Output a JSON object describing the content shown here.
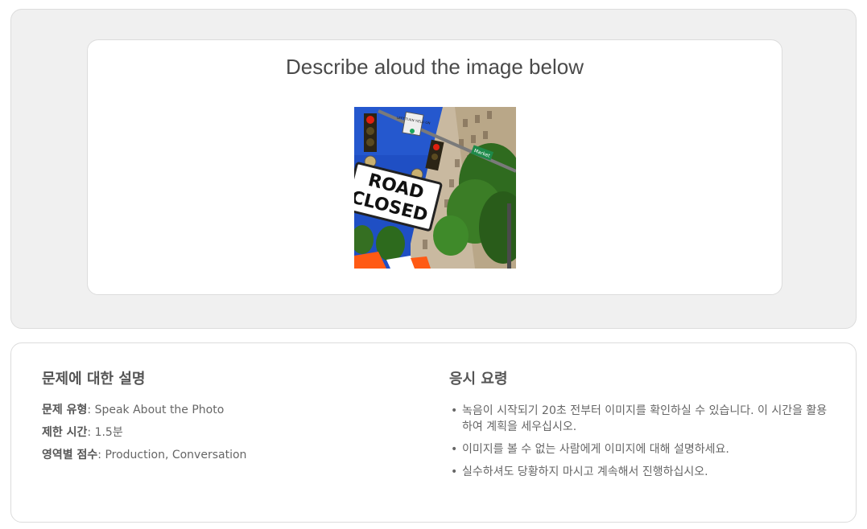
{
  "prompt": {
    "title": "Describe aloud the image below",
    "image": {
      "sign_line1": "ROAD",
      "sign_line2": "CLOSED",
      "street_sign": "Market",
      "small_sign": "LEFT TURN YIELD ON"
    }
  },
  "description": {
    "heading": "문제에 대한 설명",
    "rows": [
      {
        "label": "문제 유형",
        "value": "Speak About the Photo"
      },
      {
        "label": "제한 시간",
        "value": "1.5분"
      },
      {
        "label": "영역별 점수",
        "value": "Production, Conversation"
      }
    ]
  },
  "tips": {
    "heading": "응시 요령",
    "items": [
      "녹음이 시작되기 20초 전부터 이미지를 확인하실 수 있습니다. 이 시간을 활용하여 계획을 세우십시오.",
      "이미지를 볼 수 없는 사람에게 이미지에 대해 설명하세요.",
      "실수하셔도 당황하지 마시고 계속해서 진행하십시오."
    ]
  },
  "colors": {
    "panel_bg": "#f0f0f0",
    "border": "#dcdcdc",
    "sky": "#1f4fc4",
    "barrier_orange": "#ff5a14"
  }
}
